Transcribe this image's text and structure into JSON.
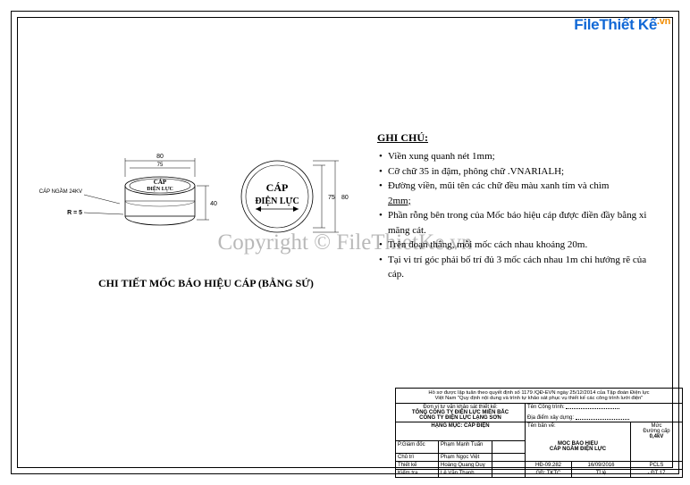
{
  "logo": {
    "part1": "File",
    "part2": "Thiết Kế",
    "tld": ".vn"
  },
  "watermark": "Copyright © FileThietKe.vn",
  "drawing": {
    "dim_top_outer": "80",
    "dim_top_inner": "75",
    "dim_height": "40",
    "dim_circle_d": "75",
    "dim_circle_outer": "80",
    "cable_label": "CÁP NGẦM 24KV",
    "radius_label": "R = 5",
    "text_line1": "CÁP",
    "text_line2": "ĐIỆN LỰC",
    "caption": "CHI TIẾT MỐC BÁO HIỆU CÁP (BẰNG SỨ)"
  },
  "notes": {
    "heading": "GHI CHÚ:",
    "items": [
      "Viền xung quanh nét 1mm;",
      "Cỡ chữ 35 in đậm, phông chữ .VNARIALH;",
      "Đường viền, mũi tên các chữ đều màu xanh tím và chìm",
      "Phần rỗng bên trong của Mốc báo hiệu cáp được điền đầy bằng xi măng cát.",
      "Trên đoạn thẳng, mỗi mốc cách nhau khoảng 20m.",
      "Tại vi trí góc phải bố trí đủ 3 mốc cách nhau 1m chỉ hướng rẽ của cáp."
    ],
    "underline_token": "2mm;"
  },
  "titleblock": {
    "header1": "Hồ sơ được lập tuân theo quyết định số 1179 /QĐ-EVN ngày 25/12/2014 của Tập đoàn Điện lực",
    "header2": "Việt Nam \"Quy định nội dung và trình tự khảo sát phục vụ thiết kế các công trình lưới điện\"",
    "agency_intro": "Đơn vị tư vấn khảo sát thiết kế:",
    "agency1": "TỔNG CÔNG TY ĐIỆN LỰC MIỀN BẮC",
    "agency2": "CÔNG TY ĐIỆN LỰC LẠNG SƠN",
    "project_name_lbl": "Tên Công trình:",
    "location_lbl": "Địa điểm xây dựng:",
    "category_lbl": "HẠNG MỤC: CÁP ĐIỆN",
    "drawing_name_lbl": "Tên bản vẽ:",
    "drawing_name_1": "MỐC BÁO HIỆU",
    "drawing_name_2": "CÁP NGẦM ĐIỆN LỰC",
    "scale_lbl": "Mức",
    "scale_caption": "Đường cấp",
    "scale_val": "0,4kV",
    "roles": [
      {
        "role": "P.Giám đốc",
        "name": "Phạm Mạnh Tuấn"
      },
      {
        "role": "Chủ trì",
        "name": "Phạm Ngọc Việt"
      },
      {
        "role": "Thiết kế",
        "name": "Hoàng Quang Duy"
      },
      {
        "role": "Kiểm tra",
        "name": "Lê Văn Thanh"
      }
    ],
    "code": "HĐ-09.282",
    "date": "16/09/2016",
    "stage_lbl": "GĐ: TKTC",
    "weight_lbl": "Tỉ lệ",
    "sheet": "PCLS",
    "sheet_sub": "- ĐT 17"
  }
}
